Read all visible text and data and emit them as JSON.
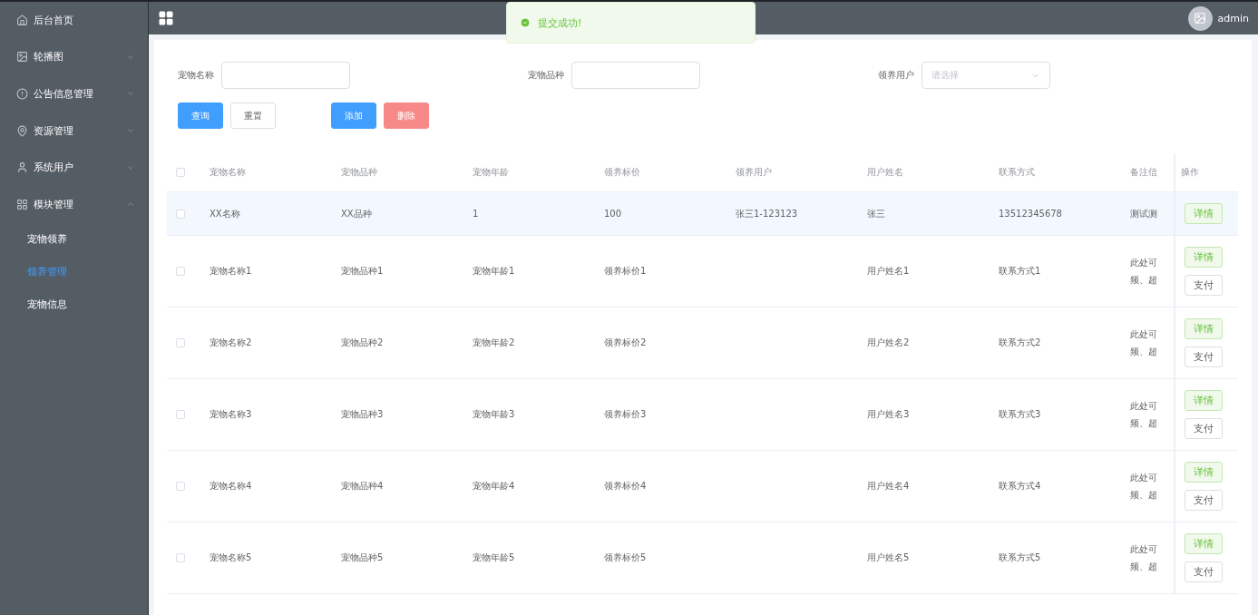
{
  "sidebar": {
    "items": [
      {
        "label": "后台首页",
        "has_arrow": false
      },
      {
        "label": "轮播图",
        "has_arrow": true,
        "expanded": false
      },
      {
        "label": "公告信息管理",
        "has_arrow": true,
        "expanded": false
      },
      {
        "label": "资源管理",
        "has_arrow": true,
        "expanded": false
      },
      {
        "label": "系统用户",
        "has_arrow": true,
        "expanded": false
      },
      {
        "label": "模块管理",
        "has_arrow": true,
        "expanded": true,
        "children": [
          {
            "label": "宠物领养",
            "selected": false
          },
          {
            "label": "领养管理",
            "selected": true
          },
          {
            "label": "宠物信息",
            "selected": false
          }
        ]
      }
    ]
  },
  "header": {
    "user": "admin"
  },
  "toast": {
    "message": "提交成功!"
  },
  "filters": [
    {
      "label": "宠物名称",
      "kind": "input"
    },
    {
      "label": "宠物品种",
      "kind": "input"
    },
    {
      "label": "领养用户",
      "kind": "select",
      "placeholder": "请选择"
    }
  ],
  "buttons": [
    {
      "label": "查询",
      "kind": "primary"
    },
    {
      "label": "重置",
      "kind": "default"
    },
    {
      "label": "添加",
      "kind": "primary"
    },
    {
      "label": "删除",
      "kind": "danger"
    }
  ],
  "table": {
    "columns": [
      "宠物名称",
      "宠物品种",
      "宠物年龄",
      "领养标价",
      "领养用户",
      "用户姓名",
      "联系方式",
      "备注信"
    ],
    "action_column": "操作",
    "header_checked": false,
    "rows": [
      {
        "checked": false,
        "hovered": true,
        "cells": [
          "XX名称",
          "XX品种",
          "1",
          "100",
          "张三1-123123",
          "张三",
          "13512345678"
        ],
        "remark": [
          "测试测"
        ],
        "actions": [
          "详情"
        ]
      },
      {
        "checked": false,
        "hovered": false,
        "cells": [
          "宠物名称1",
          "宠物品种1",
          "宠物年龄1",
          "领养标价1",
          "",
          "用户姓名1",
          "联系方式1"
        ],
        "remark": [
          "此处可",
          "频、超"
        ],
        "actions": [
          "详情",
          "支付"
        ]
      },
      {
        "checked": false,
        "hovered": false,
        "cells": [
          "宠物名称2",
          "宠物品种2",
          "宠物年龄2",
          "领养标价2",
          "",
          "用户姓名2",
          "联系方式2"
        ],
        "remark": [
          "此处可",
          "频、超"
        ],
        "actions": [
          "详情",
          "支付"
        ]
      },
      {
        "checked": false,
        "hovered": false,
        "cells": [
          "宠物名称3",
          "宠物品种3",
          "宠物年龄3",
          "领养标价3",
          "",
          "用户姓名3",
          "联系方式3"
        ],
        "remark": [
          "此处可",
          "频、超"
        ],
        "actions": [
          "详情",
          "支付"
        ]
      },
      {
        "checked": false,
        "hovered": false,
        "cells": [
          "宠物名称4",
          "宠物品种4",
          "宠物年龄4",
          "领养标价4",
          "",
          "用户姓名4",
          "联系方式4"
        ],
        "remark": [
          "此处可",
          "频、超"
        ],
        "actions": [
          "详情",
          "支付"
        ]
      },
      {
        "checked": false,
        "hovered": false,
        "cells": [
          "宠物名称5",
          "宠物品种5",
          "宠物年龄5",
          "领养标价5",
          "",
          "用户姓名5",
          "联系方式5"
        ],
        "remark": [
          "此处可",
          "频、超"
        ],
        "actions": [
          "详情",
          "支付"
        ]
      }
    ]
  }
}
